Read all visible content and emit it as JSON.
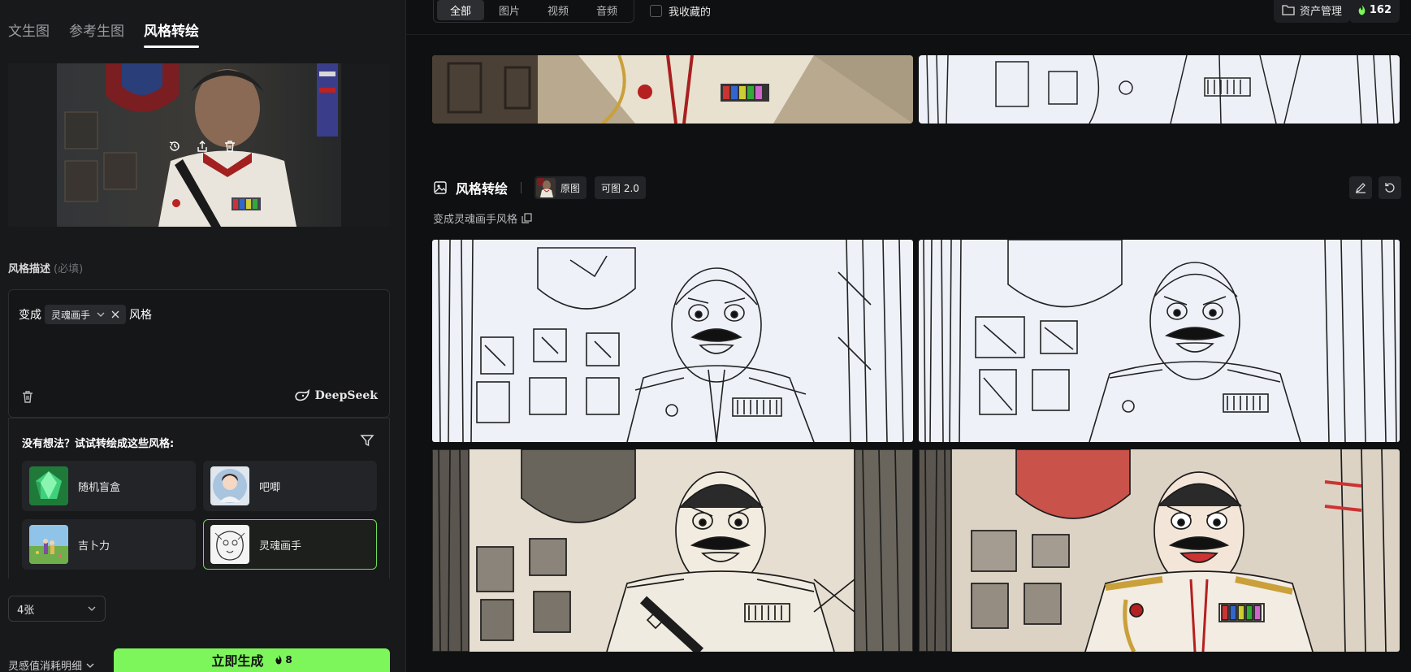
{
  "tabs": [
    {
      "label": "文生图"
    },
    {
      "label": "参考生图"
    },
    {
      "label": "风格转绘",
      "active": true
    }
  ],
  "style_desc": {
    "label": "风格描述",
    "required": "(必填)"
  },
  "prompt": {
    "prefix": "变成",
    "chip": "灵魂画手",
    "suffix": "风格",
    "engine": "DeepSeek"
  },
  "suggest": {
    "title": "没有想法？试试转绘成这些风格:",
    "styles": [
      {
        "name": "随机盲盒",
        "icon": "gem-icon"
      },
      {
        "name": "吧唧"
      },
      {
        "name": "吉卜力"
      },
      {
        "name": "灵魂画手",
        "selected": true
      }
    ]
  },
  "count": {
    "value": "4张"
  },
  "cost_detail": "灵感值消耗明细",
  "generate": {
    "label": "立即生成",
    "cost": "8"
  },
  "filters": [
    "全部",
    "图片",
    "视频",
    "音频"
  ],
  "favorites": "我收藏的",
  "asset_manage": "资产管理",
  "points": "162",
  "group": {
    "title": "风格转绘",
    "tag_original": "原图",
    "tag_model": "可图 2.0",
    "prompt": "变成灵魂画手风格"
  },
  "colors": {
    "accent": "#7cf65b",
    "bg": "#0f1011",
    "panel": "#18191b"
  }
}
